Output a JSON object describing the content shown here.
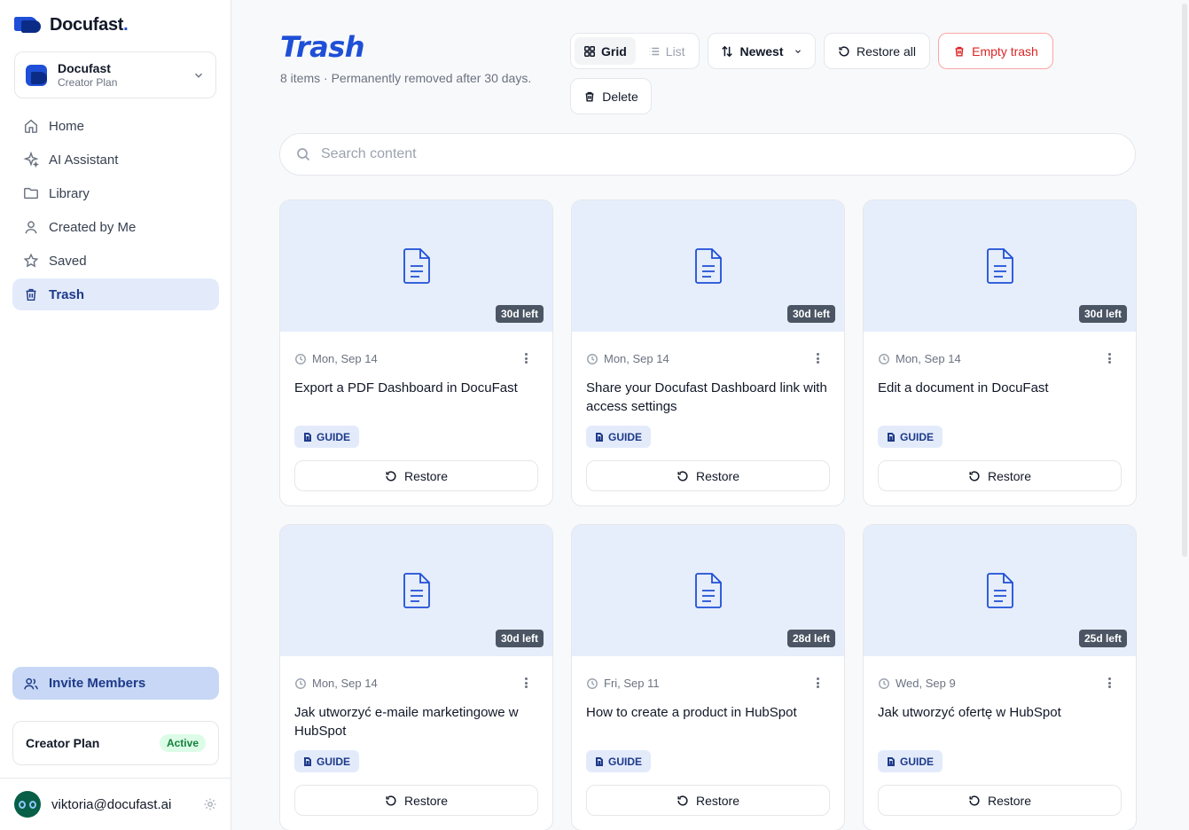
{
  "brand": {
    "name": "Docufast",
    "dot": "."
  },
  "workspace": {
    "name": "Docufast",
    "plan": "Creator Plan"
  },
  "nav": {
    "items": [
      {
        "label": "Home",
        "icon": "home-icon"
      },
      {
        "label": "AI Assistant",
        "icon": "sparkle-icon"
      },
      {
        "label": "Library",
        "icon": "folder-icon"
      },
      {
        "label": "Created by Me",
        "icon": "user-icon"
      },
      {
        "label": "Saved",
        "icon": "star-icon"
      },
      {
        "label": "Trash",
        "icon": "trash-icon",
        "active": true
      }
    ]
  },
  "invite": {
    "label": "Invite Members"
  },
  "plan_card": {
    "name": "Creator Plan",
    "status": "Active"
  },
  "user": {
    "email": "viktoria@docufast.ai"
  },
  "page": {
    "title": "Trash",
    "subtitle": "8 items · Permanently removed after 30 days."
  },
  "toolbar": {
    "grid_label": "Grid",
    "list_label": "List",
    "sort_label": "Newest",
    "restore_all_label": "Restore all",
    "empty_trash_label": "Empty trash",
    "delete_label": "Delete"
  },
  "search": {
    "placeholder": "Search content"
  },
  "cards": [
    {
      "days_left": "30d left",
      "date": "Mon, Sep 14",
      "title": "Export a PDF Dashboard in DocuFast",
      "tag": "GUIDE",
      "restore_label": "Restore"
    },
    {
      "days_left": "30d left",
      "date": "Mon, Sep 14",
      "title": "Share your Docufast Dashboard link with access settings",
      "tag": "GUIDE",
      "restore_label": "Restore"
    },
    {
      "days_left": "30d left",
      "date": "Mon, Sep 14",
      "title": "Edit a document in DocuFast",
      "tag": "GUIDE",
      "restore_label": "Restore"
    },
    {
      "days_left": "30d left",
      "date": "Mon, Sep 14",
      "title": "Jak utworzyć e-maile marketingowe w HubSpot",
      "tag": "GUIDE",
      "restore_label": "Restore"
    },
    {
      "days_left": "28d left",
      "date": "Fri, Sep 11",
      "title": "How to create a product in HubSpot",
      "tag": "GUIDE",
      "restore_label": "Restore"
    },
    {
      "days_left": "25d left",
      "date": "Wed, Sep 9",
      "title": "Jak utworzyć ofertę w HubSpot",
      "tag": "GUIDE",
      "restore_label": "Restore"
    }
  ],
  "colors": {
    "accent": "#1e4fd6",
    "danger": "#dc2626",
    "active_bg": "#e3ebfb",
    "thumb_bg": "#e6edfb"
  }
}
